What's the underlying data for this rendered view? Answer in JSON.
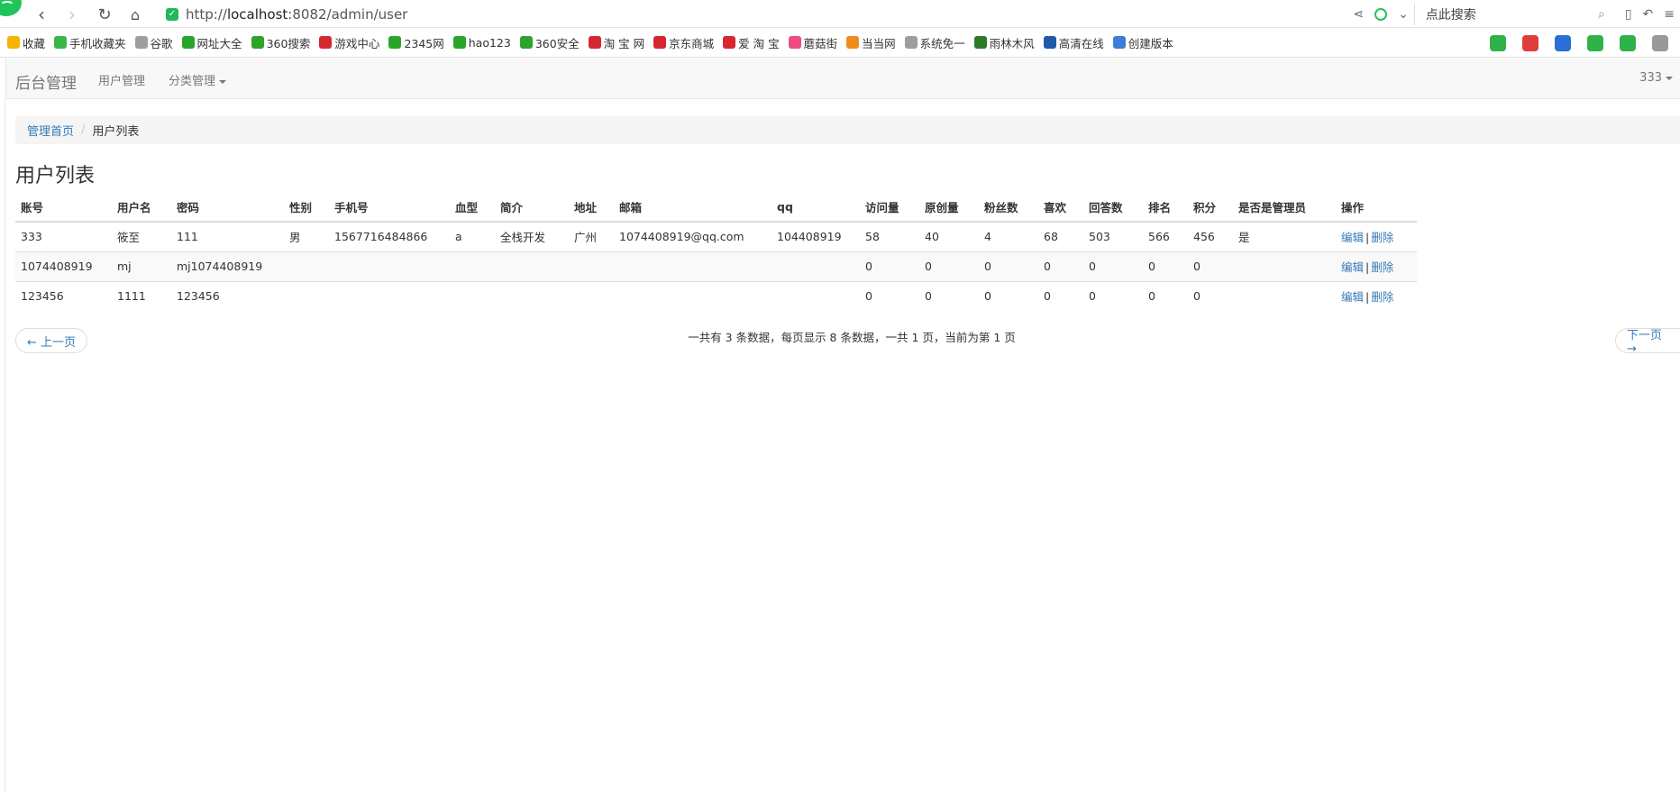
{
  "browser": {
    "url_prefix": "http://",
    "url_host": "localhost",
    "url_rest": ":8082/admin/user",
    "search_placeholder": "点此搜索",
    "bookmarks": [
      {
        "label": "收藏",
        "color": "#f5b400"
      },
      {
        "label": "手机收藏夹",
        "color": "#39b54a"
      },
      {
        "label": "谷歌",
        "color": "#9e9e9e"
      },
      {
        "label": "网址大全",
        "color": "#2aa52a"
      },
      {
        "label": "360搜索",
        "color": "#2aa52a"
      },
      {
        "label": "游戏中心",
        "color": "#d6262f"
      },
      {
        "label": "2345网",
        "color": "#2aa52a"
      },
      {
        "label": "hao123",
        "color": "#2aa52a"
      },
      {
        "label": "360安全",
        "color": "#2aa52a"
      },
      {
        "label": "淘 宝 网",
        "color": "#d6262f"
      },
      {
        "label": "京东商城",
        "color": "#d6262f"
      },
      {
        "label": "爱 淘 宝",
        "color": "#d6262f"
      },
      {
        "label": "蘑菇街",
        "color": "#ef4b82"
      },
      {
        "label": "当当网",
        "color": "#f28a1d"
      },
      {
        "label": "系统免一",
        "color": "#9e9e9e"
      },
      {
        "label": "雨林木风",
        "color": "#2a7a2a"
      },
      {
        "label": "高清在线",
        "color": "#1d5aa8"
      },
      {
        "label": "创建版本",
        "color": "#3d7fd6"
      }
    ]
  },
  "nav": {
    "brand": "后台管理",
    "user_management": "用户管理",
    "category_management": "分类管理",
    "current_user": "333"
  },
  "breadcrumb": {
    "home": "管理首页",
    "current": "用户列表"
  },
  "page_title": "用户列表",
  "table": {
    "headers": [
      "账号",
      "用户名",
      "密码",
      "性别",
      "手机号",
      "血型",
      "简介",
      "地址",
      "邮箱",
      "qq",
      "访问量",
      "原创量",
      "粉丝数",
      "喜欢",
      "回答数",
      "排名",
      "积分",
      "是否是管理员",
      "操作"
    ],
    "rows": [
      [
        "333",
        "筱至",
        "111",
        "男",
        "1567716484866",
        "a",
        "全栈开发",
        "广州",
        "1074408919@qq.com",
        "104408919",
        "58",
        "40",
        "4",
        "68",
        "503",
        "566",
        "456",
        "是"
      ],
      [
        "1074408919",
        "mj",
        "mj1074408919",
        "",
        "",
        "",
        "",
        "",
        "",
        "",
        "0",
        "0",
        "0",
        "0",
        "0",
        "0",
        "0",
        ""
      ],
      [
        "123456",
        "1111",
        "123456",
        "",
        "",
        "",
        "",
        "",
        "",
        "",
        "0",
        "0",
        "0",
        "0",
        "0",
        "0",
        "0",
        ""
      ]
    ],
    "edit_label": "编辑",
    "separator": "|",
    "delete_label": "删除"
  },
  "pagination": {
    "prev": "← 上一页",
    "next": "下一页 →",
    "info": "一共有 3 条数据，每页显示 8 条数据，一共 1 页，当前为第 1 页"
  }
}
